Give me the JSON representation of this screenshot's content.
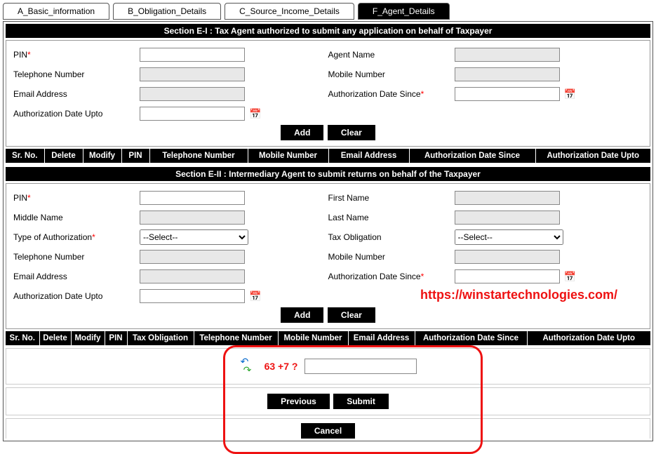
{
  "tabs": {
    "a": "A_Basic_information",
    "b": "B_Obligation_Details",
    "c": "C_Source_Income_Details",
    "f": "F_Agent_Details"
  },
  "section_e1": {
    "title": "Section E-I : Tax Agent authorized to submit any application on behalf of Taxpayer",
    "labels": {
      "pin": "PIN",
      "agent_name": "Agent Name",
      "telephone": "Telephone Number",
      "mobile": "Mobile Number",
      "email": "Email Address",
      "auth_since": "Authorization Date Since",
      "auth_upto": "Authorization Date Upto"
    },
    "headers": {
      "srno": "Sr. No.",
      "delete": "Delete",
      "modify": "Modify",
      "pin": "PIN",
      "telephone": "Telephone Number",
      "mobile": "Mobile Number",
      "email": "Email Address",
      "since": "Authorization Date Since",
      "upto": "Authorization Date Upto"
    }
  },
  "section_e2": {
    "title": "Section E-II : Intermediary Agent to submit returns on behalf of the Taxpayer",
    "labels": {
      "pin": "PIN",
      "first_name": "First Name",
      "middle_name": "Middle Name",
      "last_name": "Last Name",
      "type_auth": "Type of Authorization",
      "tax_obl": "Tax Obligation",
      "telephone": "Telephone Number",
      "mobile": "Mobile Number",
      "email": "Email Address",
      "auth_since": "Authorization Date Since",
      "auth_upto": "Authorization Date Upto"
    },
    "select_placeholder": "--Select--",
    "headers": {
      "srno": "Sr. No.",
      "delete": "Delete",
      "modify": "Modify",
      "pin": "PIN",
      "tax_obl": "Tax Obligation",
      "telephone": "Telephone Number",
      "mobile": "Mobile Number",
      "email": "Email Address",
      "since": "Authorization Date Since",
      "upto": "Authorization Date Upto"
    }
  },
  "buttons": {
    "add": "Add",
    "clear": "Clear",
    "previous": "Previous",
    "submit": "Submit",
    "cancel": "Cancel"
  },
  "captcha": {
    "question": "63 +7 ?"
  },
  "watermark": "https://winstartechnologies.com/"
}
